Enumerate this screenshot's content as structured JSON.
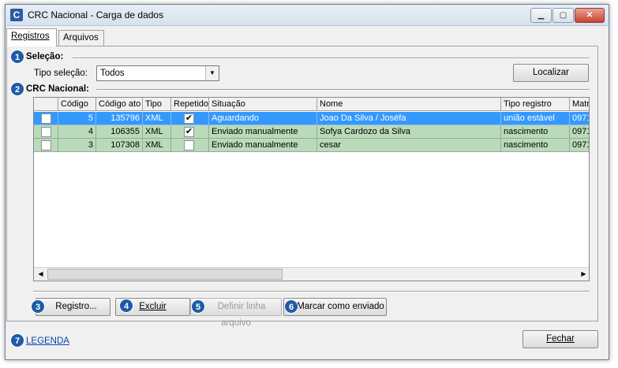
{
  "window": {
    "title": "CRC Nacional - Carga de dados",
    "icon": "C",
    "min_glyph": "▁",
    "max_glyph": "▢",
    "close_glyph": "✕"
  },
  "tabs": [
    {
      "label": "Registros"
    },
    {
      "label": "Arquivos"
    }
  ],
  "markers": [
    "1",
    "2",
    "3",
    "4",
    "5",
    "6",
    "7"
  ],
  "selecao": {
    "title": "Seleção:",
    "tipo_label": "Tipo seleção:",
    "tipo_value": "Todos",
    "localizar": "Localizar"
  },
  "crc": {
    "title": "CRC Nacional:"
  },
  "grid": {
    "columns": [
      "",
      "Código",
      "Código ato",
      "Tipo",
      "Repetido",
      "Situação",
      "Nome",
      "Tipo registro",
      "Matr"
    ],
    "rows": [
      {
        "codigo": "5",
        "codigo_ato": "135796",
        "tipo": "XML",
        "repetido": true,
        "situacao": "Aguardando",
        "nome": "Joao Da Silva / Joséfa",
        "tipo_registro": "união estável",
        "matr": "0971"
      },
      {
        "codigo": "4",
        "codigo_ato": "106355",
        "tipo": "XML",
        "repetido": true,
        "situacao": "Enviado manualmente",
        "nome": "Sofya Cardozo da Silva",
        "tipo_registro": "nascimento",
        "matr": "0971"
      },
      {
        "codigo": "3",
        "codigo_ato": "107308",
        "tipo": "XML",
        "repetido": false,
        "situacao": "Enviado manualmente",
        "nome": "cesar",
        "tipo_registro": "nascimento",
        "matr": "0971"
      }
    ]
  },
  "actions": {
    "registro": "Registro...",
    "excluir": "Excluir",
    "definir": "Definir linha arquivo",
    "marcar": "Marcar como enviado"
  },
  "footer": {
    "legenda": "LEGENDA",
    "fechar": "Fechar"
  },
  "colors": {
    "selected_row": "#3399ff",
    "sent_row": "#b9dbb9",
    "marker": "#1f5aa6"
  }
}
